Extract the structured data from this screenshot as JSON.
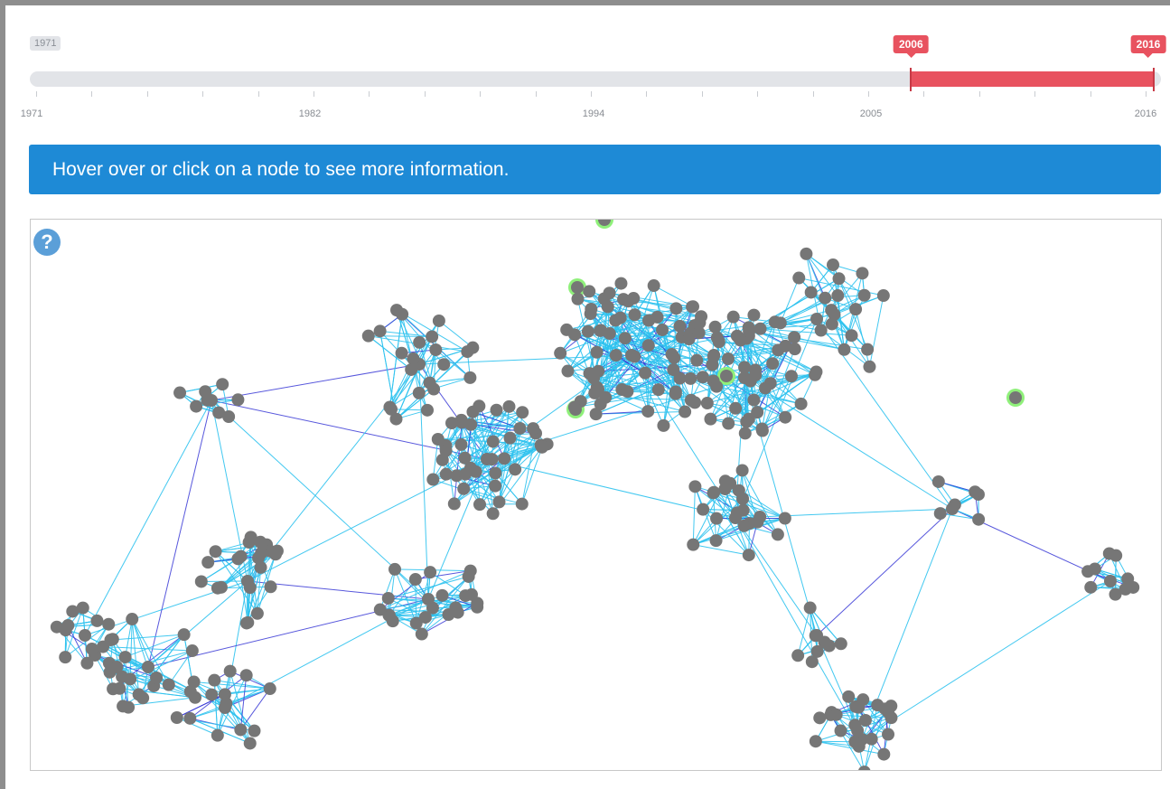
{
  "slider": {
    "min_label": "1971",
    "range_start_label": "2006",
    "range_end_label": "2016",
    "range_start_fraction": 0.779,
    "range_end_fraction": 1.0,
    "tick_labels": [
      "1971",
      "1982",
      "1994",
      "2005",
      "2016"
    ],
    "colors": {
      "track": "#e2e4e8",
      "selection": "#e8525f"
    }
  },
  "banner": {
    "text": "Hover over or click on a node to see more information."
  },
  "graph": {
    "help_icon": "?",
    "colors": {
      "edge": "#2ec2ee",
      "edge_dark": "#3a3ad6",
      "node": "#767676",
      "highlight": "#8ff07a"
    }
  }
}
